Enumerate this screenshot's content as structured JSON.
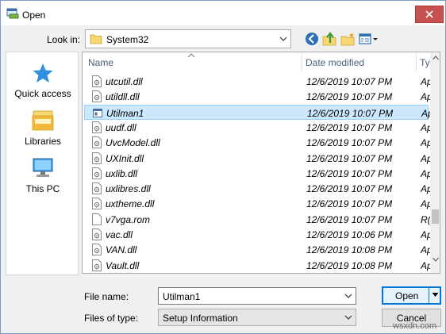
{
  "window": {
    "title": "Open"
  },
  "toolbar": {
    "look_in_label": "Look in:",
    "look_in_value": "System32"
  },
  "places": [
    {
      "label": "Quick access",
      "icon": "star-icon"
    },
    {
      "label": "Libraries",
      "icon": "libraries-icon"
    },
    {
      "label": "This PC",
      "icon": "computer-icon"
    }
  ],
  "columns": {
    "name": "Name",
    "date": "Date modified",
    "type": "Ty"
  },
  "files": [
    {
      "name": "utcutil.dll",
      "date": "12/6/2019 10:07 PM",
      "type": "Ap",
      "selected": false,
      "icon": "dll-icon"
    },
    {
      "name": "utildll.dll",
      "date": "12/6/2019 10:07 PM",
      "type": "Ap",
      "selected": false,
      "icon": "dll-icon"
    },
    {
      "name": "Utilman1",
      "date": "12/6/2019 10:07 PM",
      "type": "Ap",
      "selected": true,
      "icon": "app-window-icon"
    },
    {
      "name": "uudf.dll",
      "date": "12/6/2019 10:07 PM",
      "type": "Ap",
      "selected": false,
      "icon": "dll-icon"
    },
    {
      "name": "UvcModel.dll",
      "date": "12/6/2019 10:07 PM",
      "type": "Ap",
      "selected": false,
      "icon": "dll-icon"
    },
    {
      "name": "UXInit.dll",
      "date": "12/6/2019 10:07 PM",
      "type": "Ap",
      "selected": false,
      "icon": "dll-icon"
    },
    {
      "name": "uxlib.dll",
      "date": "12/6/2019 10:07 PM",
      "type": "Ap",
      "selected": false,
      "icon": "dll-icon"
    },
    {
      "name": "uxlibres.dll",
      "date": "12/6/2019 10:07 PM",
      "type": "Ap",
      "selected": false,
      "icon": "dll-icon"
    },
    {
      "name": "uxtheme.dll",
      "date": "12/6/2019 10:07 PM",
      "type": "Ap",
      "selected": false,
      "icon": "dll-icon"
    },
    {
      "name": "v7vga.rom",
      "date": "12/6/2019 10:07 PM",
      "type": "R(",
      "selected": false,
      "icon": "file-icon"
    },
    {
      "name": "vac.dll",
      "date": "12/6/2019 10:06 PM",
      "type": "Ap",
      "selected": false,
      "icon": "dll-icon"
    },
    {
      "name": "VAN.dll",
      "date": "12/6/2019 10:08 PM",
      "type": "Ap",
      "selected": false,
      "icon": "dll-icon"
    },
    {
      "name": "Vault.dll",
      "date": "12/6/2019 10:08 PM",
      "type": "Ap",
      "selected": false,
      "icon": "dll-icon"
    }
  ],
  "footer": {
    "file_name_label": "File name:",
    "file_name_value": "Utilman1",
    "file_type_label": "Files of type:",
    "file_type_value": "Setup Information",
    "open_label": "Open",
    "cancel_label": "Cancel"
  },
  "watermark": "wsxdn.com",
  "colors": {
    "selection": "#cce8ff",
    "accent": "#0078d7",
    "close": "#c75050"
  }
}
